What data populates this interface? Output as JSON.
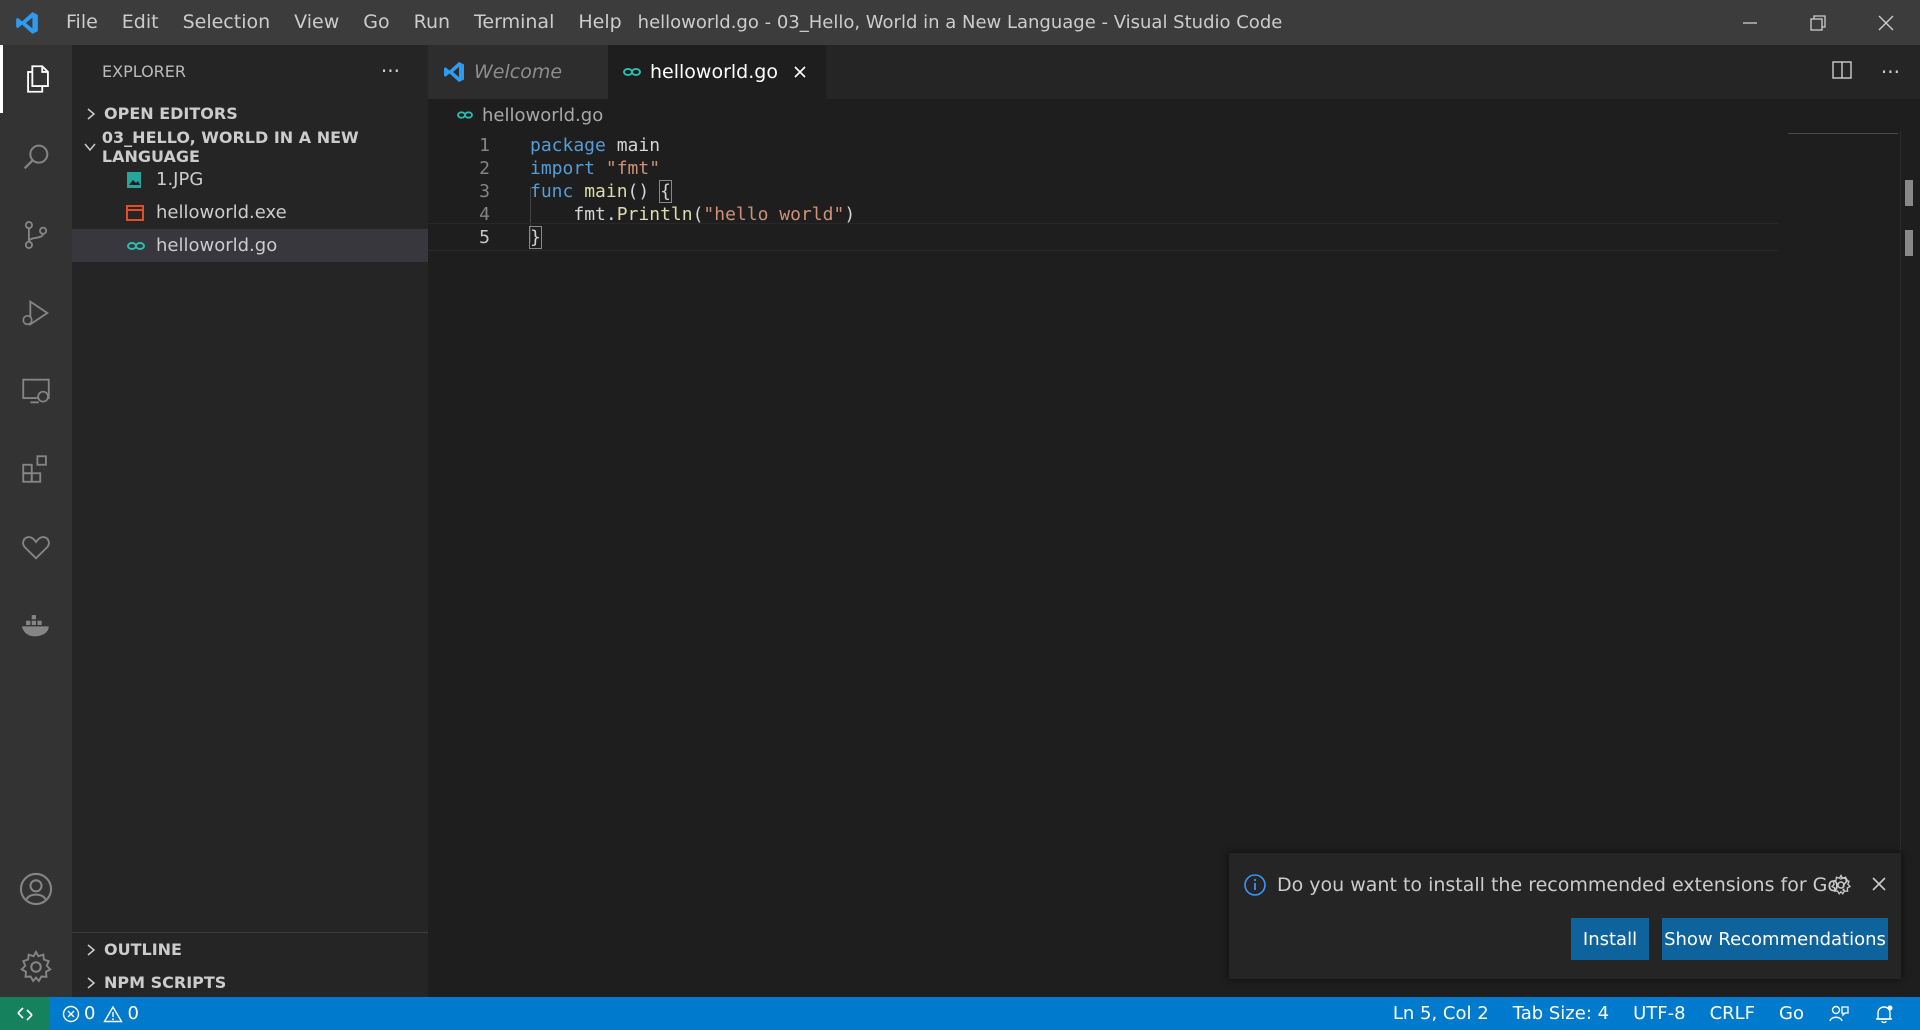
{
  "window": {
    "title": "helloworld.go - 03_Hello, World in a New Language - Visual Studio Code"
  },
  "menu": [
    "File",
    "Edit",
    "Selection",
    "View",
    "Go",
    "Run",
    "Terminal",
    "Help"
  ],
  "sidebar": {
    "title": "EXPLORER",
    "more": "···",
    "open_editors": "OPEN EDITORS",
    "folder": "03_HELLO, WORLD IN A NEW LANGUAGE",
    "files": [
      {
        "name": "1.JPG",
        "icon": "image-file-icon"
      },
      {
        "name": "helloworld.exe",
        "icon": "exe-file-icon"
      },
      {
        "name": "helloworld.go",
        "icon": "go-file-icon"
      }
    ],
    "outline": "OUTLINE",
    "npm_scripts": "NPM SCRIPTS"
  },
  "tabs": [
    {
      "label": "Welcome",
      "active": false
    },
    {
      "label": "helloworld.go",
      "active": true
    }
  ],
  "tab_actions": {
    "more": "···"
  },
  "breadcrumb": {
    "file": "helloworld.go"
  },
  "editor": {
    "line_numbers": [
      "1",
      "2",
      "3",
      "4",
      "5"
    ],
    "tokens": {
      "l1_kw": "package",
      "l1_rest": " main",
      "l2_kw": "import",
      "l2_str": " \"fmt\"",
      "l3_kw": "func",
      "l3_fn": " main",
      "l3_paren": "() ",
      "l3_brace": "{",
      "l4_indent": "    ",
      "l4_pkg": "fmt.",
      "l4_fn": "Println",
      "l4_open": "(",
      "l4_str": "\"hello world\"",
      "l4_close": ")",
      "l5_brace": "}"
    },
    "current_line": "5"
  },
  "notification": {
    "message": "Do you want to install the recommended extensions for Go?",
    "install_label": "Install",
    "show_label": "Show Recommendations"
  },
  "statusbar": {
    "errors": "0",
    "warnings": "0",
    "position": "Ln 5, Col 2",
    "tab_size": "Tab Size: 4",
    "encoding": "UTF-8",
    "eol": "CRLF",
    "language": "Go"
  },
  "colors": {
    "accent": "#007acc",
    "remote": "#16825d",
    "button": "#0e639c",
    "keyword": "#569cd6",
    "function": "#dcdcaa",
    "string": "#ce9178"
  }
}
